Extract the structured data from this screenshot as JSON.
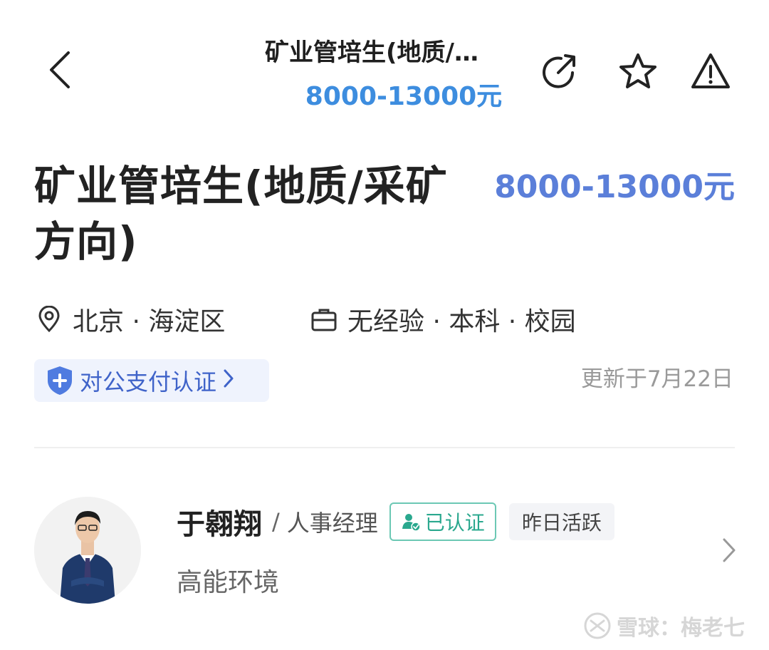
{
  "nav": {
    "title": "矿业管培生(地质/…",
    "salary": "8000-13000元",
    "icons": [
      "back-icon",
      "share-icon",
      "star-icon",
      "warning-icon"
    ]
  },
  "job": {
    "title": "矿业管培生(地质/采矿方向)",
    "salary": "8000-13000元",
    "location": "北京 · 海淀区",
    "requirements": "无经验 · 本科 · 校园",
    "pay_verification": "对公支付认证",
    "updated": "更新于7月22日"
  },
  "recruiter": {
    "name": "于翱翔",
    "role": "人事经理",
    "verified_label": "已认证",
    "active_label": "昨日活跃",
    "company": "高能环境"
  },
  "watermark": {
    "text": "雪球：梅老七"
  },
  "colors": {
    "salary_blue": "#5b7fd9",
    "nav_salary_blue": "#3d8ddf",
    "verified_green": "#2aa88e",
    "badge_bg": "#eff3fd"
  }
}
